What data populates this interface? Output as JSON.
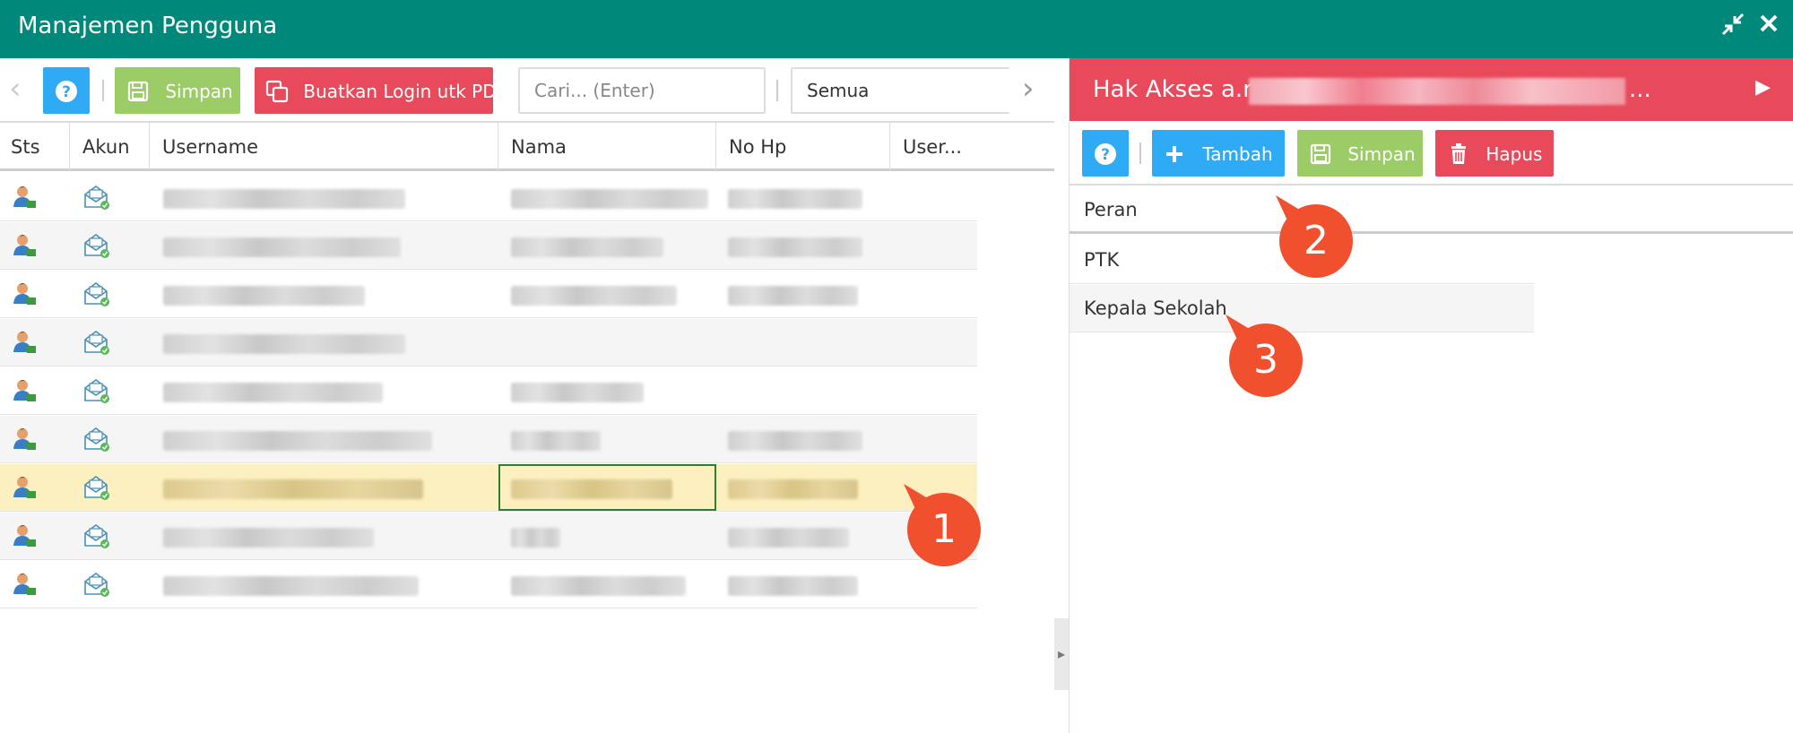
{
  "window": {
    "title": "Manajemen Pengguna",
    "restore_icon": "compress-icon",
    "close_icon": "close-icon"
  },
  "toolbar": {
    "help_label": "?",
    "save_label": "Simpan",
    "create_login_label": "Buatkan Login utk PD",
    "search_placeholder": "Cari... (Enter)",
    "filter_value": "Semua"
  },
  "grid": {
    "columns": [
      "Sts",
      "Akun",
      "Username",
      "Nama",
      "No Hp",
      "User..."
    ],
    "rows": [
      {
        "username_w": 270,
        "nama_w": 220,
        "hp_w": 150
      },
      {
        "username_w": 265,
        "nama_w": 170,
        "hp_w": 150
      },
      {
        "username_w": 225,
        "nama_w": 185,
        "hp_w": 145
      },
      {
        "username_w": 270,
        "nama_w": 0,
        "hp_w": 0
      },
      {
        "username_w": 245,
        "nama_w": 148,
        "hp_w": 0
      },
      {
        "username_w": 300,
        "nama_w": 100,
        "hp_w": 150
      },
      {
        "username_w": 290,
        "nama_w": 180,
        "hp_w": 145,
        "selected": true
      },
      {
        "username_w": 235,
        "nama_w": 55,
        "hp_w": 135
      },
      {
        "username_w": 285,
        "nama_w": 195,
        "hp_w": 145
      }
    ],
    "selected_row_index": 6
  },
  "right_panel": {
    "title_prefix": "Hak Akses a.n",
    "title_ellipsis": "...",
    "help_label": "?",
    "add_label": "Tambah",
    "save_label": "Simpan",
    "delete_label": "Hapus",
    "column": "Peran",
    "roles": [
      "PTK",
      "Kepala Sekolah"
    ]
  },
  "callouts": [
    "1",
    "2",
    "3"
  ],
  "colors": {
    "titlebar": "#00897b",
    "panel_header": "#e8495b",
    "primary": "#2faaf5",
    "success": "#9ccc65",
    "danger": "#e8495b",
    "callout": "#f0502e"
  }
}
